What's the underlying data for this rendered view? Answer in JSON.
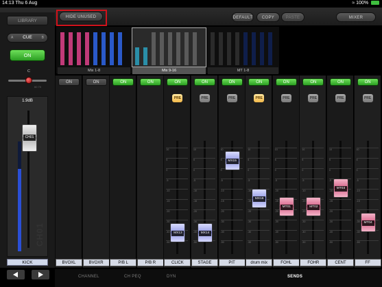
{
  "statusbar": {
    "time": "14:13",
    "date": "Thu 6 Aug",
    "battery": "100%",
    "battery_icon": "battery-icon"
  },
  "toolbar": {
    "hide_unused": "HIDE UNUSED",
    "default": "DEFAULT",
    "copy": "COPY",
    "paste": "PASTE",
    "mixer": "MIXER"
  },
  "left": {
    "library": "LIBRARY",
    "cue_a": "A",
    "cue_label": "CUE",
    "cue_b": "B",
    "on": "ON",
    "pan_center": "C",
    "pan_lr": "60  70",
    "gain_value": "1.9dB",
    "channel_fader_label": "CH01",
    "channel_watermark": "CH01",
    "channel_meter_level": 0.75,
    "channel_name": "KICK"
  },
  "overview": {
    "groups": [
      {
        "label": "Mix 1-8",
        "selected": false
      },
      {
        "label": "Mix 9-16",
        "selected": true
      },
      {
        "label": "MT 1-8",
        "selected": false
      }
    ]
  },
  "strips": [
    {
      "name": "BVOXL",
      "on": "ON",
      "on_state": false,
      "pre": null,
      "fader": null
    },
    {
      "name": "BVOXR",
      "on": "ON",
      "on_state": false,
      "pre": null,
      "fader": null
    },
    {
      "name": "P/B L",
      "on": "ON",
      "on_state": true,
      "pre": null,
      "fader": null
    },
    {
      "name": "P/B R",
      "on": "ON",
      "on_state": true,
      "pre": null,
      "fader": null
    },
    {
      "name": "CLICK",
      "on": "ON",
      "on_state": true,
      "pre": "PRE",
      "pre_active": true,
      "fader": "MX13",
      "fader_color": "blue"
    },
    {
      "name": "STAGE",
      "on": "ON",
      "on_state": true,
      "pre": "PRE",
      "pre_active": false,
      "fader": "MX14",
      "fader_color": "blue"
    },
    {
      "name": "PIT",
      "on": "ON",
      "on_state": true,
      "pre": "PRE",
      "pre_active": false,
      "fader": "MX15",
      "fader_color": "blue"
    },
    {
      "name": "drum mix",
      "on": "ON",
      "on_state": true,
      "pre": "PRE",
      "pre_active": true,
      "fader": "MX16",
      "fader_color": "blue"
    },
    {
      "name": "FOHL",
      "on": "ON",
      "on_state": true,
      "pre": "PRE",
      "pre_active": false,
      "fader": "MT01",
      "fader_color": "pink"
    },
    {
      "name": "FOHR",
      "on": "ON",
      "on_state": true,
      "pre": "PRE",
      "pre_active": false,
      "fader": "MT02",
      "fader_color": "pink"
    },
    {
      "name": "CENT",
      "on": "ON",
      "on_state": true,
      "pre": "PRE",
      "pre_active": false,
      "fader": "MT03",
      "fader_color": "pink"
    },
    {
      "name": "FF",
      "on": "ON",
      "on_state": true,
      "pre": "PRE",
      "pre_active": false,
      "fader": "MT04",
      "fader_color": "pink"
    }
  ],
  "scale_ticks": [
    "10",
    "5",
    "0",
    "-5",
    "-10",
    "-15",
    "-20",
    "-30",
    "-40",
    "-50"
  ],
  "bottom_nav": {
    "channel": "CHANNEL",
    "chpeq": "CH PEQ",
    "dyn": "DYN",
    "sends": "SENDS"
  }
}
